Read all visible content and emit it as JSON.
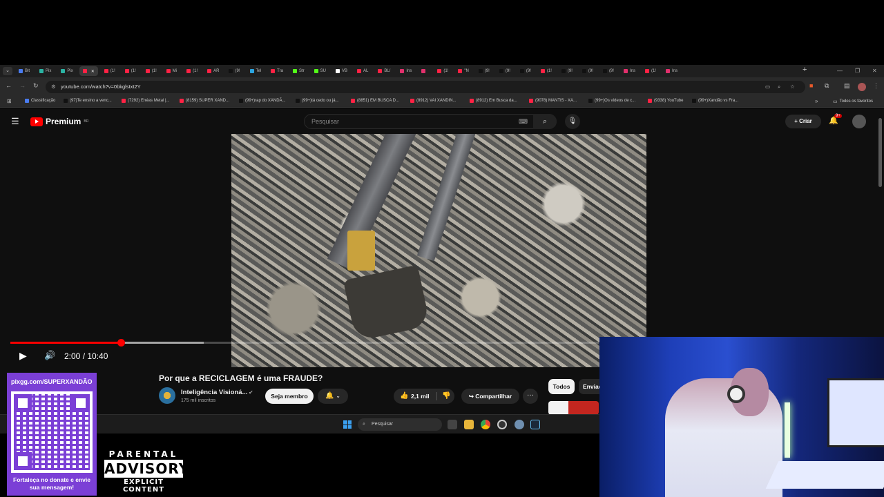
{
  "browser": {
    "tabs": [
      {
        "label": "Bit",
        "color": "#4a7cf0"
      },
      {
        "label": "Pix",
        "color": "#2bb3a3"
      },
      {
        "label": "Pix",
        "color": "#2bb3a3"
      },
      {
        "label": "",
        "color": "#ff2244",
        "active": true
      },
      {
        "label": "(1!",
        "color": "#ff2244"
      },
      {
        "label": "(1!",
        "color": "#ff2244"
      },
      {
        "label": "(1!",
        "color": "#ff2244"
      },
      {
        "label": "Mi",
        "color": "#ff2244"
      },
      {
        "label": "(1!",
        "color": "#ff2244"
      },
      {
        "label": "AR",
        "color": "#ff2244"
      },
      {
        "label": "(9!",
        "color": "#111111"
      },
      {
        "label": "Tel",
        "color": "#2ca5e0"
      },
      {
        "label": "Tra",
        "color": "#ff2244"
      },
      {
        "label": "Str",
        "color": "#53fc18"
      },
      {
        "label": "SU",
        "color": "#53fc18"
      },
      {
        "label": "VB",
        "color": "#ffffff"
      },
      {
        "label": "AL",
        "color": "#ff2244"
      },
      {
        "label": "BL/",
        "color": "#ff2244"
      },
      {
        "label": "Ins",
        "color": "#e1306c"
      },
      {
        "label": "",
        "color": "#e1306c"
      },
      {
        "label": "(1!",
        "color": "#ff2244"
      },
      {
        "label": "\"N",
        "color": "#ff2244"
      },
      {
        "label": "(9!",
        "color": "#111111"
      },
      {
        "label": "(9!",
        "color": "#111111"
      },
      {
        "label": "(9!",
        "color": "#111111"
      },
      {
        "label": "(1!",
        "color": "#ff2244"
      },
      {
        "label": "(9!",
        "color": "#111111"
      },
      {
        "label": "(9!",
        "color": "#111111"
      },
      {
        "label": "(9!",
        "color": "#111111"
      },
      {
        "label": "Ins",
        "color": "#e1306c"
      },
      {
        "label": "(1!",
        "color": "#ff2244"
      },
      {
        "label": "Ins",
        "color": "#e1306c"
      }
    ],
    "tab_close": "✕",
    "new_tab": "+",
    "url": "youtube.com/watch?v=0bkglstxt2Y",
    "bookmarks": [
      {
        "label": "Classificação",
        "color": "#4a7cf0"
      },
      {
        "label": "(97)Te ensino a venc...",
        "color": "#111111"
      },
      {
        "label": "(7292) Enéas Metal |...",
        "color": "#ff2244"
      },
      {
        "label": "(8159) SUPER XAND...",
        "color": "#ff2244"
      },
      {
        "label": "(99+)rap do XANDÃ...",
        "color": "#111111"
      },
      {
        "label": "(99+)tá cedo ou já...",
        "color": "#111111"
      },
      {
        "label": "(8851) EM BUSCA D...",
        "color": "#ff2244"
      },
      {
        "label": "(8912) VAI XANDIN...",
        "color": "#ff2244"
      },
      {
        "label": "(8912) Em Busca da...",
        "color": "#ff2244"
      },
      {
        "label": "(9078) MANTIS - XA...",
        "color": "#ff2244"
      },
      {
        "label": "(99+)Os vídeos de c...",
        "color": "#111111"
      },
      {
        "label": "(9338) YouTube",
        "color": "#ff2244"
      },
      {
        "label": "(99+)Xandão vs Fra...",
        "color": "#111111"
      }
    ],
    "all_bookmarks": "Todos os favoritos"
  },
  "youtube": {
    "logo_text": "Premium",
    "logo_region": "BR",
    "search_placeholder": "Pesquisar",
    "create_label": "Criar",
    "notification_count": "9+",
    "player": {
      "time": "2:00 / 10:40",
      "progress_fraction": 0.1875
    },
    "video_title": "Por que a RECICLAGEM é uma FRAUDE?",
    "channel_name": "Inteligência Visioná...",
    "subscribers": "175 mil inscritos",
    "join_label": "Seja membro",
    "likes": "2,1 mil",
    "share_label": "Compartilhar",
    "chips": [
      "Todos",
      "Enviad"
    ]
  },
  "taskbar": {
    "search_placeholder": "Pesquisar"
  },
  "overlay": {
    "donate_url": "pixgg.com/SUPERXANDÃO",
    "donate_message": "Fortaleça no donate e envie sua mensagem!",
    "advisory_top": "PARENTAL",
    "advisory_mid": "ADVISORY",
    "advisory_bot": "EXPLICIT CONTENT"
  }
}
